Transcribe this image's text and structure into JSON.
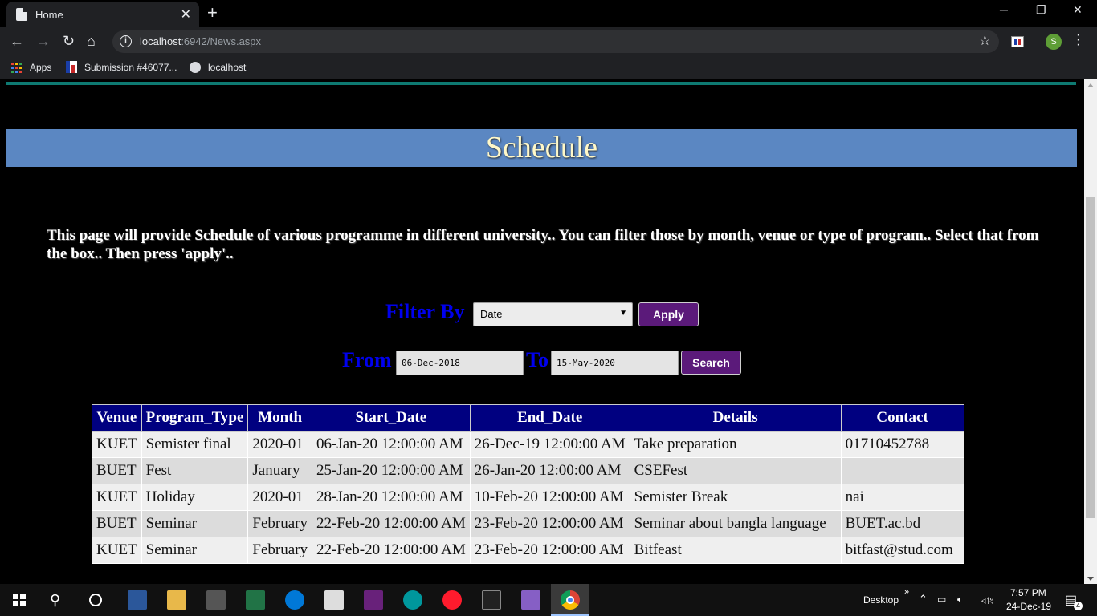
{
  "browser": {
    "tab_title": "Home",
    "url_host": "localhost",
    "url_path": ":6942/News.aspx",
    "profile_initial": "S",
    "bookmarks": [
      {
        "label": "Apps",
        "icon": "apps-grid-icon"
      },
      {
        "label": "Submission #46077...",
        "icon": "bookmark-favicon-icon"
      },
      {
        "label": "localhost",
        "icon": "globe-icon"
      }
    ]
  },
  "page": {
    "title": "Schedule",
    "intro": "This page will provide Schedule of various programme in different university.. You can filter those by month, venue or type of program.. Select that from the box.. Then press 'apply'..",
    "filter_label": "Filter By",
    "filter_selected": "Date",
    "apply_label": "Apply",
    "from_label": "From",
    "from_value": "06-Dec-2018",
    "to_label": "To",
    "to_value": "15-May-2020",
    "search_label": "Search"
  },
  "table": {
    "headers": [
      "Venue",
      "Program_Type",
      "Month",
      "Start_Date",
      "End_Date",
      "Details",
      "Contact"
    ],
    "rows": [
      [
        "KUET",
        "Semister final",
        "2020-01",
        "06-Jan-20 12:00:00 AM",
        "26-Dec-19 12:00:00 AM",
        "Take preparation",
        "01710452788"
      ],
      [
        "BUET",
        "Fest",
        "January",
        "25-Jan-20 12:00:00 AM",
        "26-Jan-20 12:00:00 AM",
        "CSEFest",
        ""
      ],
      [
        "KUET",
        "Holiday",
        "2020-01",
        "28-Jan-20 12:00:00 AM",
        "10-Feb-20 12:00:00 AM",
        "Semister Break",
        "nai"
      ],
      [
        "BUET",
        "Seminar",
        "February",
        "22-Feb-20 12:00:00 AM",
        "23-Feb-20 12:00:00 AM",
        "Seminar about bangla language",
        "BUET.ac.bd"
      ],
      [
        "KUET",
        "Seminar",
        "February",
        "22-Feb-20 12:00:00 AM",
        "23-Feb-20 12:00:00 AM",
        "Bitfeast",
        "bitfast@stud.com"
      ]
    ]
  },
  "taskbar": {
    "desktop_label": "Desktop",
    "language": "বাং",
    "time": "7:57 PM",
    "date": "24-Dec-19",
    "notification_count": "4"
  },
  "colors": {
    "banner": "#5b87c2",
    "header_bg": "#000080",
    "button_bg": "#5b1a7a",
    "label_blue": "#0000ee"
  }
}
